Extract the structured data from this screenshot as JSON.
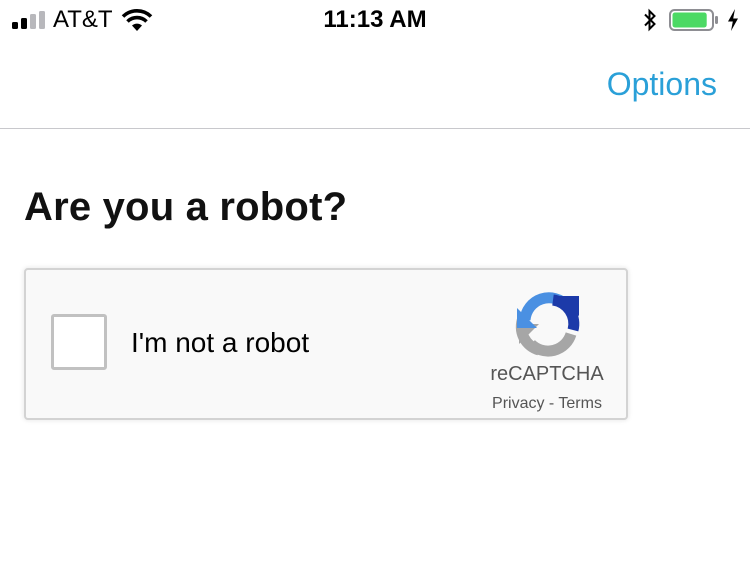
{
  "status_bar": {
    "carrier": "AT&T",
    "time": "11:13 AM",
    "signal_bars_filled": 2,
    "signal_bars_total": 4,
    "battery_level": 0.9,
    "battery_color": "#4cd964"
  },
  "nav": {
    "options_label": "Options",
    "accent_color": "#2aa0d8"
  },
  "page": {
    "title": "Are you a robot?"
  },
  "recaptcha": {
    "checkbox_label": "I'm not a robot",
    "checked": false,
    "brand": "reCAPTCHA",
    "privacy_link": "Privacy",
    "separator": " - ",
    "terms_link": "Terms",
    "logo_icon": "recaptcha-logo-icon"
  }
}
